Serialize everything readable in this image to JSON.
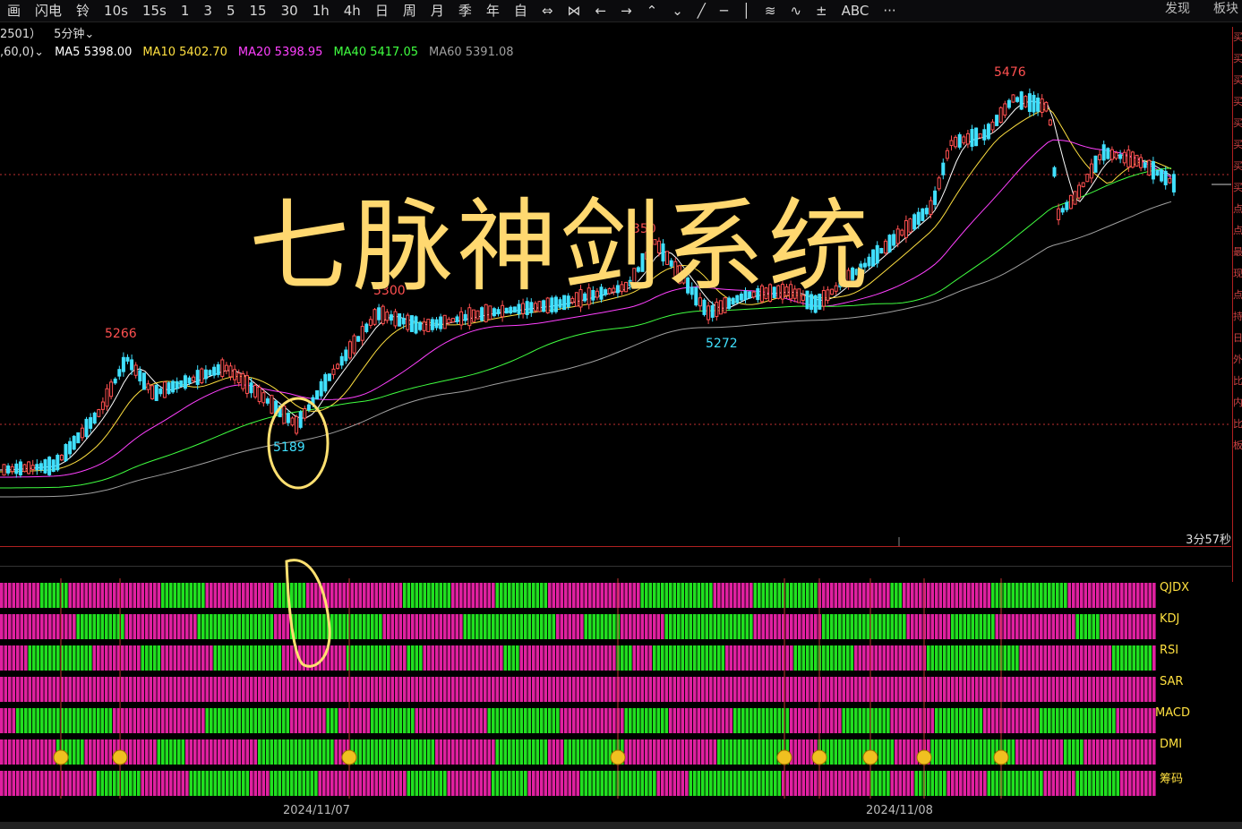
{
  "toolbar": {
    "items": [
      "画",
      "闪电",
      "铃",
      "10s",
      "15s",
      "1",
      "3",
      "5",
      "15",
      "30",
      "1h",
      "4h",
      "日",
      "周",
      "月",
      "季",
      "年",
      "自",
      "⇔",
      "⋈",
      "←",
      "→",
      "⌃",
      "⌄",
      "╱",
      "─",
      "│",
      "≋",
      "∿",
      "±",
      "ABC",
      "···"
    ],
    "right": [
      "发现",
      "板块"
    ]
  },
  "header": {
    "contract": "2501）",
    "period": "5分钟"
  },
  "ma": {
    "param": ",60,0)",
    "ma5": "MA5 5398.00",
    "ma10": "MA10 5402.70",
    "ma20": "MA20 5398.95",
    "ma40": "MA40 5417.05",
    "ma60": "MA60 5391.08",
    "colors": {
      "ma5": "#ffffff",
      "ma10": "#ffe040",
      "ma20": "#ff40ff",
      "ma40": "#40ff40",
      "ma60": "#a0a0a0"
    }
  },
  "watermark": "七脉神剑系统",
  "annotations": {
    "high1": "5266",
    "low1": "5189",
    "high2": "5300",
    "high3": "350",
    "low2": "5272",
    "high4": "5476"
  },
  "countdown": "3分57秒",
  "indicators": [
    "QJDX",
    "KDJ",
    "RSI",
    "SAR",
    "MACD",
    "DMI",
    "筹码"
  ],
  "dates": [
    "2024/11/07",
    "2024/11/08"
  ],
  "chart_data": {
    "type": "candlestick",
    "price_points": [
      {
        "label": "5266",
        "value": 5266
      },
      {
        "label": "5189",
        "value": 5189
      },
      {
        "label": "5300",
        "value": 5300
      },
      {
        "label": "5272",
        "value": 5272
      },
      {
        "label": "5476",
        "value": 5476
      }
    ]
  }
}
